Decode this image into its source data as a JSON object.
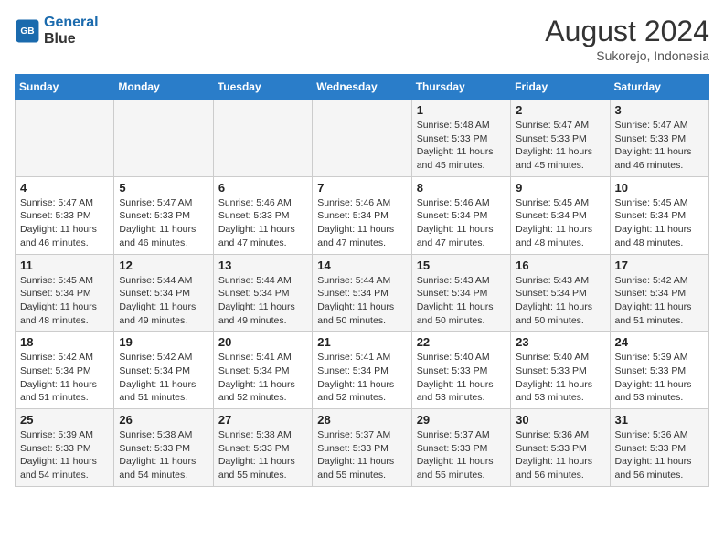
{
  "header": {
    "logo_line1": "General",
    "logo_line2": "Blue",
    "month_year": "August 2024",
    "location": "Sukorejo, Indonesia"
  },
  "days_of_week": [
    "Sunday",
    "Monday",
    "Tuesday",
    "Wednesday",
    "Thursday",
    "Friday",
    "Saturday"
  ],
  "weeks": [
    [
      {
        "day": "",
        "content": ""
      },
      {
        "day": "",
        "content": ""
      },
      {
        "day": "",
        "content": ""
      },
      {
        "day": "",
        "content": ""
      },
      {
        "day": "1",
        "content": "Sunrise: 5:48 AM\nSunset: 5:33 PM\nDaylight: 11 hours\nand 45 minutes."
      },
      {
        "day": "2",
        "content": "Sunrise: 5:47 AM\nSunset: 5:33 PM\nDaylight: 11 hours\nand 45 minutes."
      },
      {
        "day": "3",
        "content": "Sunrise: 5:47 AM\nSunset: 5:33 PM\nDaylight: 11 hours\nand 46 minutes."
      }
    ],
    [
      {
        "day": "4",
        "content": "Sunrise: 5:47 AM\nSunset: 5:33 PM\nDaylight: 11 hours\nand 46 minutes."
      },
      {
        "day": "5",
        "content": "Sunrise: 5:47 AM\nSunset: 5:33 PM\nDaylight: 11 hours\nand 46 minutes."
      },
      {
        "day": "6",
        "content": "Sunrise: 5:46 AM\nSunset: 5:33 PM\nDaylight: 11 hours\nand 47 minutes."
      },
      {
        "day": "7",
        "content": "Sunrise: 5:46 AM\nSunset: 5:34 PM\nDaylight: 11 hours\nand 47 minutes."
      },
      {
        "day": "8",
        "content": "Sunrise: 5:46 AM\nSunset: 5:34 PM\nDaylight: 11 hours\nand 47 minutes."
      },
      {
        "day": "9",
        "content": "Sunrise: 5:45 AM\nSunset: 5:34 PM\nDaylight: 11 hours\nand 48 minutes."
      },
      {
        "day": "10",
        "content": "Sunrise: 5:45 AM\nSunset: 5:34 PM\nDaylight: 11 hours\nand 48 minutes."
      }
    ],
    [
      {
        "day": "11",
        "content": "Sunrise: 5:45 AM\nSunset: 5:34 PM\nDaylight: 11 hours\nand 48 minutes."
      },
      {
        "day": "12",
        "content": "Sunrise: 5:44 AM\nSunset: 5:34 PM\nDaylight: 11 hours\nand 49 minutes."
      },
      {
        "day": "13",
        "content": "Sunrise: 5:44 AM\nSunset: 5:34 PM\nDaylight: 11 hours\nand 49 minutes."
      },
      {
        "day": "14",
        "content": "Sunrise: 5:44 AM\nSunset: 5:34 PM\nDaylight: 11 hours\nand 50 minutes."
      },
      {
        "day": "15",
        "content": "Sunrise: 5:43 AM\nSunset: 5:34 PM\nDaylight: 11 hours\nand 50 minutes."
      },
      {
        "day": "16",
        "content": "Sunrise: 5:43 AM\nSunset: 5:34 PM\nDaylight: 11 hours\nand 50 minutes."
      },
      {
        "day": "17",
        "content": "Sunrise: 5:42 AM\nSunset: 5:34 PM\nDaylight: 11 hours\nand 51 minutes."
      }
    ],
    [
      {
        "day": "18",
        "content": "Sunrise: 5:42 AM\nSunset: 5:34 PM\nDaylight: 11 hours\nand 51 minutes."
      },
      {
        "day": "19",
        "content": "Sunrise: 5:42 AM\nSunset: 5:34 PM\nDaylight: 11 hours\nand 51 minutes."
      },
      {
        "day": "20",
        "content": "Sunrise: 5:41 AM\nSunset: 5:34 PM\nDaylight: 11 hours\nand 52 minutes."
      },
      {
        "day": "21",
        "content": "Sunrise: 5:41 AM\nSunset: 5:34 PM\nDaylight: 11 hours\nand 52 minutes."
      },
      {
        "day": "22",
        "content": "Sunrise: 5:40 AM\nSunset: 5:33 PM\nDaylight: 11 hours\nand 53 minutes."
      },
      {
        "day": "23",
        "content": "Sunrise: 5:40 AM\nSunset: 5:33 PM\nDaylight: 11 hours\nand 53 minutes."
      },
      {
        "day": "24",
        "content": "Sunrise: 5:39 AM\nSunset: 5:33 PM\nDaylight: 11 hours\nand 53 minutes."
      }
    ],
    [
      {
        "day": "25",
        "content": "Sunrise: 5:39 AM\nSunset: 5:33 PM\nDaylight: 11 hours\nand 54 minutes."
      },
      {
        "day": "26",
        "content": "Sunrise: 5:38 AM\nSunset: 5:33 PM\nDaylight: 11 hours\nand 54 minutes."
      },
      {
        "day": "27",
        "content": "Sunrise: 5:38 AM\nSunset: 5:33 PM\nDaylight: 11 hours\nand 55 minutes."
      },
      {
        "day": "28",
        "content": "Sunrise: 5:37 AM\nSunset: 5:33 PM\nDaylight: 11 hours\nand 55 minutes."
      },
      {
        "day": "29",
        "content": "Sunrise: 5:37 AM\nSunset: 5:33 PM\nDaylight: 11 hours\nand 55 minutes."
      },
      {
        "day": "30",
        "content": "Sunrise: 5:36 AM\nSunset: 5:33 PM\nDaylight: 11 hours\nand 56 minutes."
      },
      {
        "day": "31",
        "content": "Sunrise: 5:36 AM\nSunset: 5:33 PM\nDaylight: 11 hours\nand 56 minutes."
      }
    ]
  ]
}
